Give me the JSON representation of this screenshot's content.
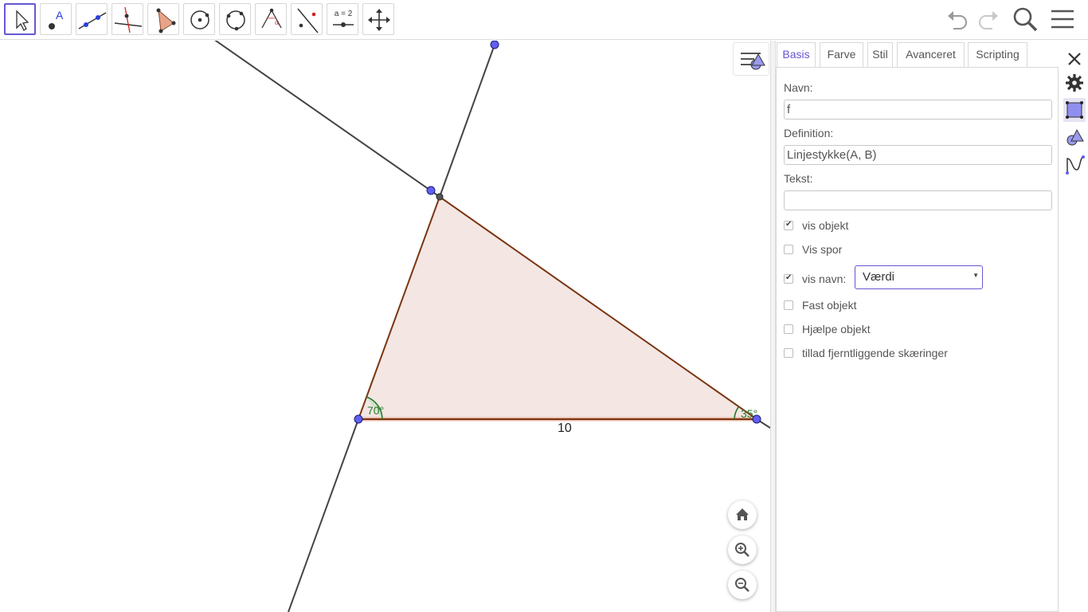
{
  "toolbar": {
    "tools": [
      {
        "name": "move-tool",
        "label": ""
      },
      {
        "name": "point-tool",
        "label": "A"
      },
      {
        "name": "line-tool",
        "label": ""
      },
      {
        "name": "perpendicular-line-tool",
        "label": ""
      },
      {
        "name": "polygon-tool",
        "label": ""
      },
      {
        "name": "circle-center-point-tool",
        "label": ""
      },
      {
        "name": "circle-three-points-tool",
        "label": ""
      },
      {
        "name": "angle-tool",
        "label": ""
      },
      {
        "name": "reflect-about-line-tool",
        "label": ""
      },
      {
        "name": "slider-tool",
        "label": "a = 2"
      },
      {
        "name": "move-graphics-view-tool",
        "label": ""
      }
    ],
    "right_icons": [
      "undo-icon",
      "redo-icon",
      "search-icon",
      "menu-icon"
    ]
  },
  "graphics": {
    "angle_a_label": "70°",
    "angle_b_label": "35°",
    "segment_label": "10",
    "fill_color": "#f3e6e3",
    "edge_color": "#7a3410",
    "point_color": "#6060ee",
    "angle_color": "#2a7a2a"
  },
  "props": {
    "tabs": [
      "Basis",
      "Farve",
      "Stil",
      "Avanceret",
      "Scripting"
    ],
    "active_tab": "Basis",
    "name_label": "Navn:",
    "name_value": "f",
    "definition_label": "Definition:",
    "definition_value": "Linjestykke(A, B)",
    "caption_label": "Tekst:",
    "caption_value": "",
    "show_object": "vis objekt",
    "show_trace": "Vis spor",
    "show_label": "vis navn:",
    "label_mode": "Værdi",
    "fix_object": "Fast objekt",
    "auxiliary_object": "Hjælpe objekt",
    "outlying_intersections": "tillad fjerntliggende skæringer",
    "accent_color": "#6557d2"
  }
}
